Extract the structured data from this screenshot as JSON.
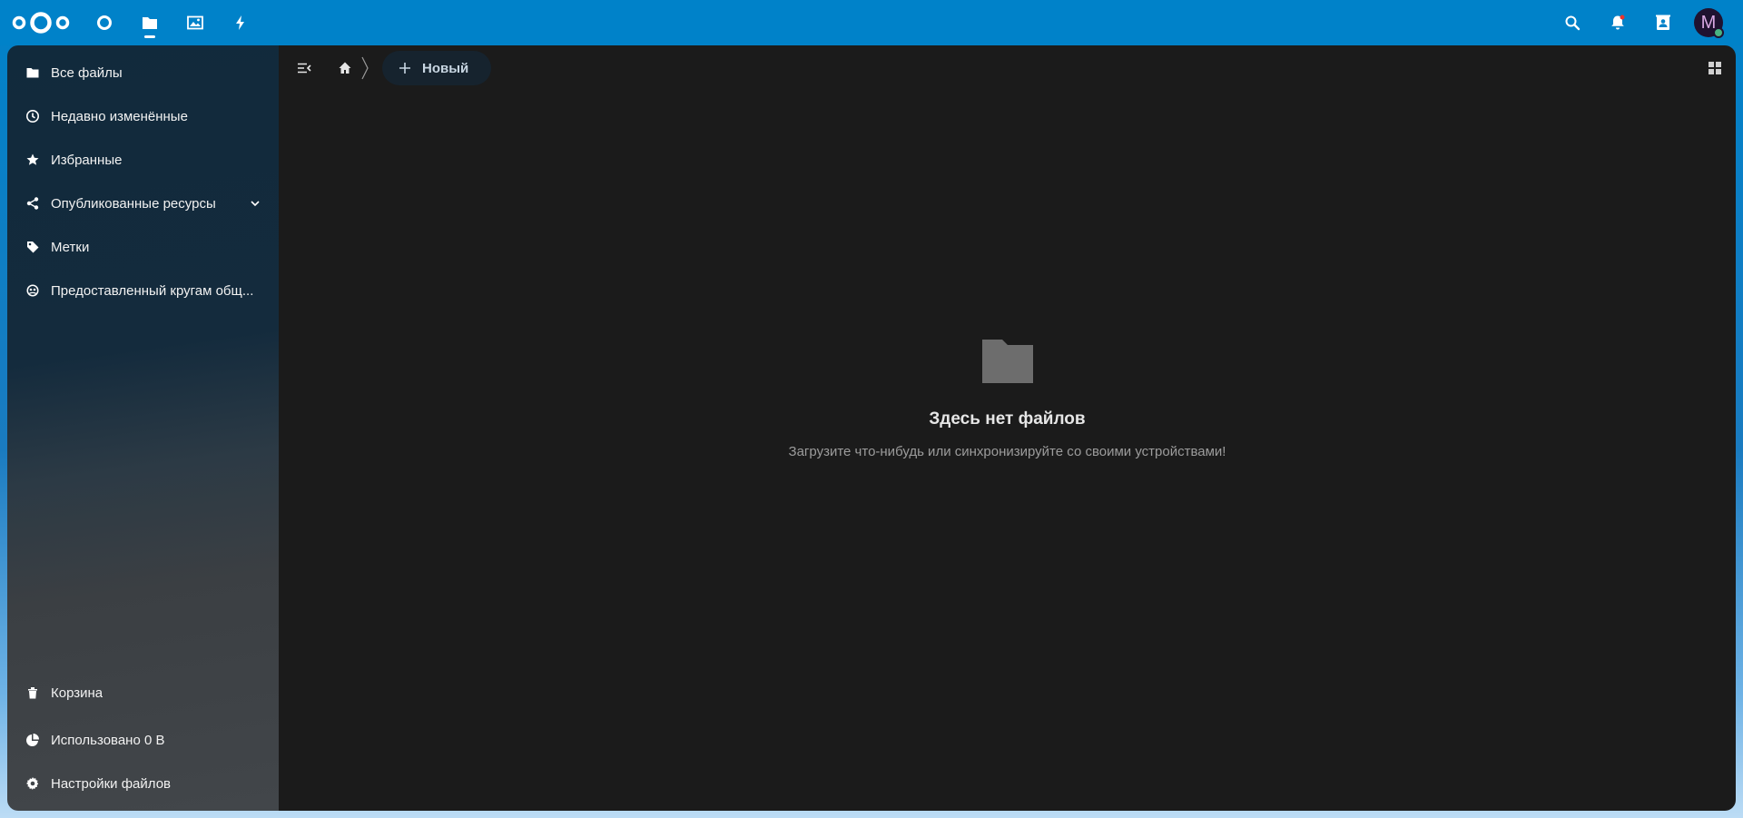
{
  "header": {
    "avatar_initial": "M",
    "apps": [
      {
        "icon": "dashboard-icon"
      },
      {
        "icon": "files-icon",
        "active": true
      },
      {
        "icon": "photos-icon"
      },
      {
        "icon": "activity-icon"
      }
    ],
    "right_icons": [
      "search-icon",
      "notifications-icon",
      "contacts-icon"
    ]
  },
  "sidebar": {
    "items": [
      {
        "label": "Все файлы",
        "icon": "folder-icon"
      },
      {
        "label": "Недавно изменённые",
        "icon": "clock-icon"
      },
      {
        "label": "Избранные",
        "icon": "star-icon"
      },
      {
        "label": "Опубликованные ресурсы",
        "icon": "share-icon"
      },
      {
        "label": "Метки",
        "icon": "tag-icon"
      },
      {
        "label": "Предоставленный кругам общ...",
        "icon": "circles-icon"
      }
    ],
    "bottom_items": [
      {
        "label": "Корзина",
        "icon": "trash-icon"
      },
      {
        "label": "Использовано 0 B",
        "icon": "pie-chart-icon"
      },
      {
        "label": "Настройки файлов",
        "icon": "gear-icon"
      }
    ]
  },
  "toolbar": {
    "new_label": "Новый"
  },
  "empty_state": {
    "title": "Здесь нет файлов",
    "description": "Загрузите что-нибудь или синхронизируйте со своими устройствами!"
  },
  "colors": {
    "header": "#0082c9",
    "main_bg": "#1b1b1b",
    "sidebar_top": "#112a3c",
    "online": "#49b382"
  }
}
